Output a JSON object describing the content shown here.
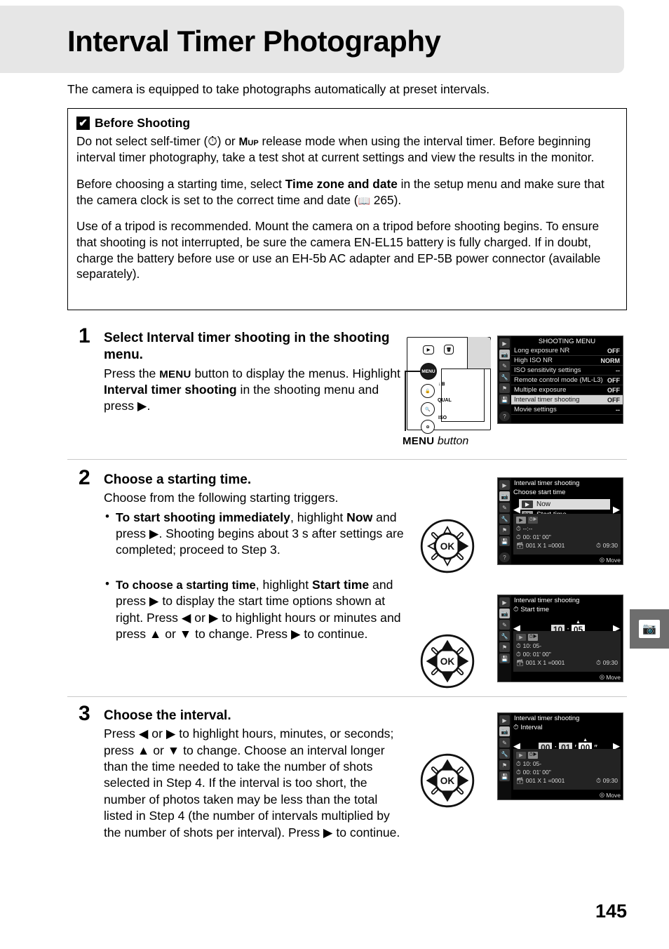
{
  "page": {
    "title": "Interval Timer Photography",
    "intro": "The camera is equipped to take photographs automatically at preset intervals.",
    "number": "145"
  },
  "warning": {
    "icon": "warning-checkmark-icon",
    "title": "Before Shooting",
    "p1_a": "Do not select self-timer (",
    "p1_selftimer_glyph": "⏱",
    "p1_b": ") or ",
    "p1_mup": "Mup",
    "p1_c": " release mode when using the interval timer.  Before beginning interval timer photography, take a test shot at current settings and view the results in the monitor.",
    "p2_a": "Before choosing a starting time, select ",
    "p2_bold": "Time zone and date",
    "p2_b": " in the setup menu and make sure that the camera clock is set to the correct time and date (",
    "p2_ref": "265",
    "p2_c": ").",
    "p3": "Use of a tripod is recommended.  Mount the camera on a tripod before shooting begins.  To ensure that shooting is not interrupted, be sure the camera EN-EL15 battery is fully charged.  If in doubt, charge the battery before use or use an EH-5b AC adapter and EP-5B power connector (available separately)."
  },
  "steps": [
    {
      "num": "1",
      "head_a": "Select ",
      "head_bold": "Interval timer shooting",
      "head_b": " in the shooting menu.",
      "body_a": "Press the ",
      "body_menu": "MENU",
      "body_b": " button to display the menus. Highlight ",
      "body_bold": "Interval timer shooting",
      "body_c": " in the shooting menu and press ",
      "body_arrow": "▶",
      "body_d": "."
    },
    {
      "num": "2",
      "head": "Choose a starting time.",
      "body": "Choose from the following starting triggers.",
      "bullets": [
        {
          "lead": "To start shooting immediately",
          "rest_a": ", highlight ",
          "bold2": "Now",
          "rest_b": " and press ",
          "arrow": "▶",
          "rest_c": ".  Shooting begins about 3 s after settings are completed; proceed to Step 3."
        },
        {
          "lead": "To choose a starting time",
          "rest_a": ", highlight ",
          "bold2": "Start time",
          "rest_b": " and press ",
          "arrow": "▶",
          "rest_c": " to display the start time options shown at right. Press ",
          "arrow_l": "◀",
          "rest_d": " or ",
          "arrow_r": "▶",
          "rest_e": " to highlight hours or minutes and press ",
          "arrow_u": "▲",
          "rest_f": " or ",
          "arrow_dn": "▼",
          "rest_g": " to change.  Press ",
          "arrow_r2": "▶",
          "rest_h": " to continue."
        }
      ]
    },
    {
      "num": "3",
      "head": "Choose the interval.",
      "body_a": "Press ",
      "arrow_l": "◀",
      "body_b": " or ",
      "arrow_r": "▶",
      "body_c": " to highlight hours, minutes, or seconds; press ",
      "arrow_u": "▲",
      "body_d": " or ",
      "arrow_dn": "▼",
      "body_e": " to change.  Choose an interval longer than the time needed to take the number of shots selected in Step 4.  If the interval is too short, the number of photos taken may be less than the total listed in Step 4 (the number of intervals multiplied by the number of shots per interval).  Press ",
      "arrow_r2": "▶",
      "body_f": " to continue."
    }
  ],
  "camera_figure": {
    "caption_bold": "MENU",
    "caption_italic": " button",
    "buttons": {
      "play": "▶",
      "trash": "🗑",
      "menu": "MENU",
      "b2_label": "↓⊞",
      "b3_label": "QUAL",
      "b4_label": "ISO"
    }
  },
  "shooting_menu": {
    "title": "SHOOTING MENU",
    "sidebar_icons": [
      "playback-icon",
      "camera-icon",
      "pencil-icon",
      "wrench-icon",
      "flag-icon",
      "save-icon",
      "help-icon"
    ],
    "rows": [
      {
        "label": "Long exposure NR",
        "value": "OFF",
        "selected": false
      },
      {
        "label": "High ISO NR",
        "value": "NORM",
        "selected": false
      },
      {
        "label": "ISO sensitivity settings",
        "value": "--",
        "selected": false
      },
      {
        "label": "Remote control mode (ML-L3)",
        "value": "OFF",
        "selected": false
      },
      {
        "label": "Multiple exposure",
        "value": "OFF",
        "selected": false
      },
      {
        "label": "Interval timer shooting",
        "value": "OFF",
        "selected": true
      },
      {
        "label": "Movie settings",
        "value": "--",
        "selected": false
      }
    ]
  },
  "screen_start_choice": {
    "title": "Interval timer shooting",
    "subhead": "Choose start time",
    "options": [
      {
        "glyph": "▶",
        "label": "Now",
        "selected": true
      },
      {
        "glyph": "⏱▶",
        "label": "Start time",
        "selected": false
      }
    ],
    "info": {
      "badge1": "▶",
      "badge2": "⏱▶",
      "starttime_icon": "clock-icon",
      "starttime": "--:--",
      "interval_icon": "interval-icon",
      "interval": "00: 01' 00\"",
      "shots_icon": "frames-icon",
      "shots": "001  X 1 =0001",
      "clock_icon": "clock-icon",
      "clock": "09:30"
    },
    "footer": "Move"
  },
  "screen_start_time": {
    "title": "Interval timer shooting",
    "subhead": "Start time",
    "hours": "10",
    "sep": ":",
    "minutes": "05",
    "info": {
      "badge1": "▶",
      "badge2": "⏱▶",
      "starttime": "10: 05-",
      "interval": "00: 01' 00\"",
      "shots": "001  X 1 =0001",
      "clock": "09:30"
    },
    "footer": "Move"
  },
  "screen_interval": {
    "title": "Interval timer shooting",
    "subhead": "Interval",
    "hours": "00",
    "minutes": "01",
    "seconds": "00",
    "info": {
      "badge1": "▶",
      "badge2": "⏱▶",
      "starttime": "10: 05-",
      "interval": "00: 01' 00\"",
      "shots": "001  X 1 =0001",
      "clock": "09:30"
    },
    "footer": "Move"
  },
  "side_tab": {
    "icon": "camera-shooting-menu-icon"
  },
  "colors": {
    "header_band": "#e6e6e6",
    "lcd_bg": "#000000",
    "lcd_highlight": "#d4d4d4",
    "side_tab": "#6e6e6e"
  }
}
